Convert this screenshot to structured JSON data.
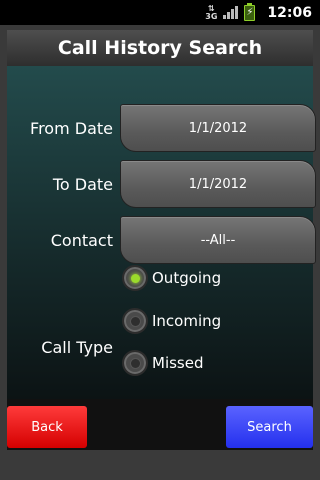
{
  "status_bar": {
    "network_type": "3G",
    "time": "12:06",
    "icons": [
      "network-3g-icon",
      "signal-icon",
      "battery-charging-icon"
    ]
  },
  "header": {
    "title": "Call History Search"
  },
  "form": {
    "from_date": {
      "label": "From Date",
      "value": "1/1/2012"
    },
    "to_date": {
      "label": "To Date",
      "value": "1/1/2012"
    },
    "contact": {
      "label": "Contact",
      "value": "--All--"
    },
    "call_type": {
      "label": "Call Type",
      "options": [
        {
          "label": "Outgoing",
          "selected": true
        },
        {
          "label": "Incoming",
          "selected": false
        },
        {
          "label": "Missed",
          "selected": false
        }
      ]
    }
  },
  "buttons": {
    "back": "Back",
    "search": "Search"
  },
  "colors": {
    "back_button": "#e00000",
    "search_button": "#3a44f5",
    "selected_radio": "#9bdb2b",
    "panel_top": "#234b4c"
  }
}
